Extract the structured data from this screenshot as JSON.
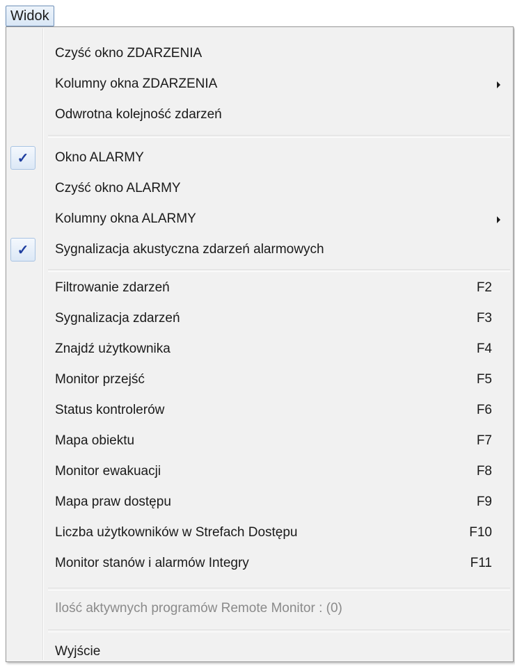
{
  "menubar": {
    "title": "Widok"
  },
  "menu": {
    "items": [
      {
        "label": "Czyść okno ZDARZENIA"
      },
      {
        "label": "Kolumny okna ZDARZENIA",
        "submenu": true
      },
      {
        "label": "Odwrotna kolejność zdarzeń"
      },
      {
        "label": "Okno ALARMY",
        "checked": true
      },
      {
        "label": "Czyść okno ALARMY"
      },
      {
        "label": "Kolumny okna ALARMY",
        "submenu": true
      },
      {
        "label": "Sygnalizacja akustyczna zdarzeń alarmowych",
        "checked": true
      },
      {
        "label": "Filtrowanie zdarzeń",
        "shortcut": "F2"
      },
      {
        "label": "Sygnalizacja zdarzeń",
        "shortcut": "F3"
      },
      {
        "label": "Znajdź użytkownika",
        "shortcut": "F4"
      },
      {
        "label": "Monitor przejść",
        "shortcut": "F5"
      },
      {
        "label": "Status kontrolerów",
        "shortcut": "F6"
      },
      {
        "label": "Mapa obiektu",
        "shortcut": "F7"
      },
      {
        "label": "Monitor ewakuacji",
        "shortcut": "F8"
      },
      {
        "label": "Mapa praw dostępu",
        "shortcut": "F9"
      },
      {
        "label": "Liczba użytkowników w Strefach Dostępu",
        "shortcut": "F10"
      },
      {
        "label": "Monitor stanów i alarmów Integry",
        "shortcut": "F11"
      },
      {
        "label": "Ilość aktywnych programów Remote Monitor : (0)",
        "disabled": true
      },
      {
        "label": "Wyjście"
      }
    ],
    "check_glyph": "✓"
  }
}
